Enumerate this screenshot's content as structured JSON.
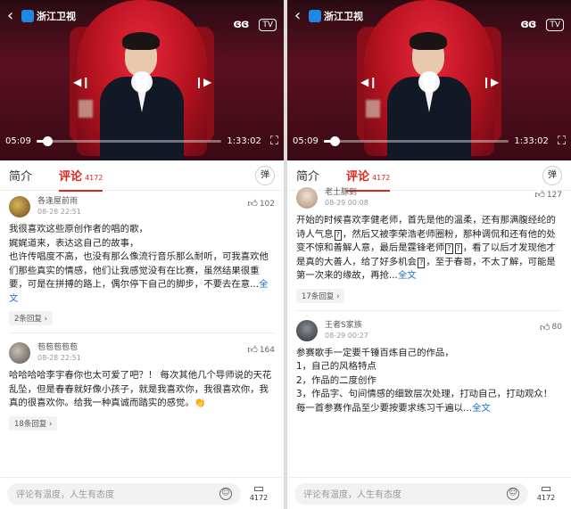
{
  "colors": {
    "accent": "#e2231a",
    "link": "#1e6fd9"
  },
  "left": {
    "video": {
      "channel": "浙江卫视",
      "current_time": "05:09",
      "total_time": "1:33:02",
      "progress": 0.06
    },
    "tabs": {
      "intro": "简介",
      "comments": "评论",
      "comment_count": "4172",
      "danmu_icon": "弹"
    },
    "comments": [
      {
        "user": "各逢屋前雨",
        "time": "08-28 22:51",
        "likes": "102",
        "text": "我很喜欢这些原创作者的唱的歌，\n娓娓道来，表达这自己的故事，\n也许传唱度不高，也没有那么像流行音乐那么耐听，可我喜欢他们那些真实的情感，他们让我感觉没有在比赛，虽然结果很重要，可是在拼搏的路上，偶尔停下自己的脚步，不要去在意...",
        "more": "全文",
        "replies": "2条回复"
      },
      {
        "user": "苞苞苞苞苞",
        "time": "08-28 22:51",
        "likes": "164",
        "text": "哈哈哈哈李宇春你也太可爱了吧？！ 每次其他几个导师说的天花乱坠，但是春春就好像小孩子，就是我喜欢你，我很喜欢你，我真的很喜欢你。给我一种真诚而踏实的感觉。👏",
        "more": "",
        "replies": "18条回复"
      }
    ],
    "footer": {
      "placeholder": "评论有温度，人生有态度",
      "count": "4172"
    }
  },
  "right": {
    "video": {
      "channel": "浙江卫视",
      "current_time": "05:09",
      "total_time": "1:33:02",
      "progress": 0.06
    },
    "tabs": {
      "intro": "简介",
      "comments": "评论",
      "comment_count": "4172",
      "danmu_icon": "弹"
    },
    "comments": [
      {
        "user": "老土豚到",
        "time": "08-29 00:08",
        "likes": "127",
        "text_parts": [
          "开始的时候喜欢李健老师，首先是他的温柔，还有那满腹经纶的诗人气息",
          "，然后又被李荣浩老师圈粉，那种调侃和还有他的处变不惊和善解人意，最后是霆锋老师",
          "，看了以后才发现他才是真的大善人，给了好多机会",
          "，至于春哥，不太了解，可能是第一次来的缘故，再抢..."
        ],
        "more": "全文",
        "replies": "17条回复"
      },
      {
        "user": "王者S家族",
        "time": "08-29 00:27",
        "likes": "80",
        "text": "参赛歌手一定要千锤百炼自己的作品，\n1，自己的风格特点\n2，作品的二度创作\n3，作品字、句间情感的细致层次处理，打动自己，打动观众！\n每一首参赛作品至少要按要求练习千遍以...",
        "more": "全文",
        "replies": ""
      }
    ],
    "footer": {
      "placeholder": "评论有温度，人生有态度",
      "count": "4172"
    }
  }
}
